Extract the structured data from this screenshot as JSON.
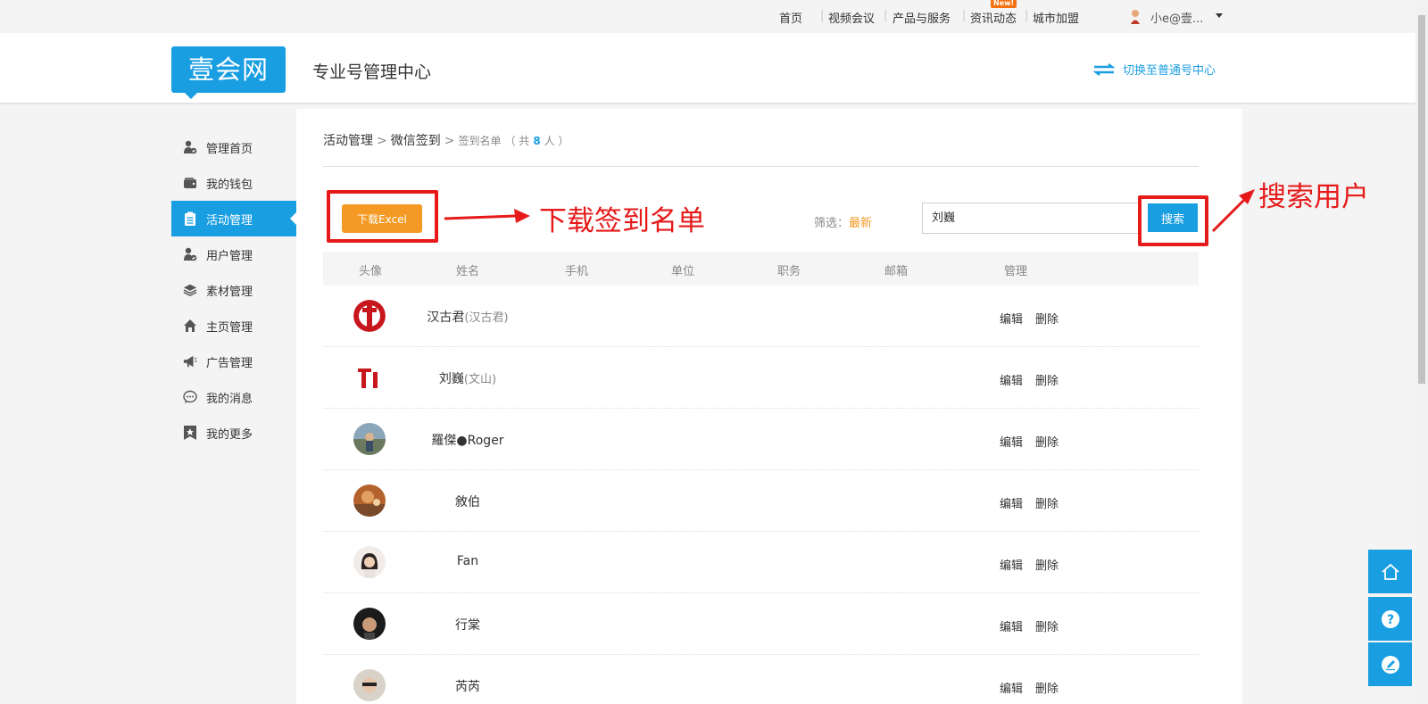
{
  "topbar": {
    "nav": [
      "首页",
      "视频会议",
      "产品与服务",
      "资讯动态",
      "城市加盟"
    ],
    "new_badge": "New!",
    "user_name": "小e@壹..."
  },
  "header": {
    "logo": "壹会网",
    "title": "专业号管理中心",
    "switch_label": "切换至普通号中心"
  },
  "sidebar": {
    "items": [
      {
        "label": "管理首页",
        "icon": "user-check-icon"
      },
      {
        "label": "我的钱包",
        "icon": "wallet-icon"
      },
      {
        "label": "活动管理",
        "icon": "clipboard-icon",
        "active": true
      },
      {
        "label": "用户管理",
        "icon": "user-check-icon"
      },
      {
        "label": "素材管理",
        "icon": "layers-icon"
      },
      {
        "label": "主页管理",
        "icon": "home-icon"
      },
      {
        "label": "广告管理",
        "icon": "megaphone-icon"
      },
      {
        "label": "我的消息",
        "icon": "chat-bubble-icon"
      },
      {
        "label": "我的更多",
        "icon": "star-bookmark-icon"
      }
    ]
  },
  "breadcrumb": {
    "crumb1": "活动管理",
    "crumb2": "微信签到",
    "crumb3": "签到名单",
    "count_prefix": "（ 共",
    "count": "8",
    "count_suffix": "人 ）"
  },
  "toolbar": {
    "excel_label": "下载Excel",
    "filter_label": "筛选：",
    "filter_value": "最新",
    "search_value": "刘巍",
    "search_label": "搜索"
  },
  "annotations": {
    "download_note": "下载签到名单",
    "search_note": "搜索用户"
  },
  "table": {
    "headers": [
      "头像",
      "姓名",
      "手机",
      "单位",
      "职务",
      "邮箱",
      "管理"
    ],
    "edit_label": "编辑",
    "delete_label": "删除",
    "rows": [
      {
        "name": "汉古君",
        "alias": "(汉古君)"
      },
      {
        "name": "刘巍",
        "alias": "(文山)"
      },
      {
        "name": "羅傑●Roger",
        "alias": ""
      },
      {
        "name": "敘伯",
        "alias": ""
      },
      {
        "name": "Fan",
        "alias": ""
      },
      {
        "name": "行棠",
        "alias": ""
      },
      {
        "name": "芮芮",
        "alias": ""
      }
    ]
  },
  "colors": {
    "brand_blue": "#1a9ee2",
    "orange": "#f49a24",
    "annotation_red": "#e61a1a"
  }
}
